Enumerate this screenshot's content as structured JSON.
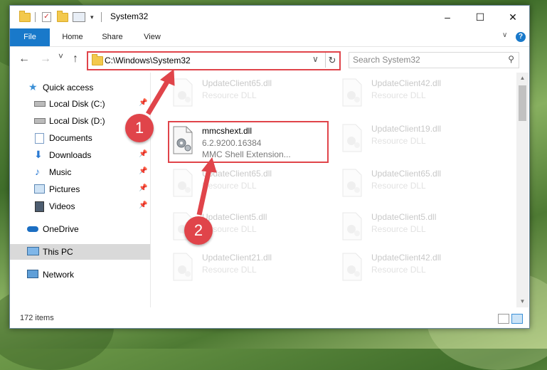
{
  "window": {
    "title": "System32",
    "controls": {
      "minimize": "–",
      "maximize": "☐",
      "close": "✕"
    }
  },
  "ribbon": {
    "tabs": [
      "File",
      "Home",
      "Share",
      "View"
    ],
    "collapse_glyph": "∨",
    "help_glyph": "?"
  },
  "navigation": {
    "back_glyph": "←",
    "forward_glyph": "→",
    "recent_glyph": "˅",
    "up_glyph": "↑",
    "address": "C:\\Windows\\System32",
    "address_drop_glyph": "∨",
    "refresh_glyph": "↻",
    "search_placeholder": "Search System32",
    "search_glyph": "⚲"
  },
  "sidebar": {
    "items": [
      {
        "label": "Quick access",
        "icon": "star-icon",
        "pinned": false
      },
      {
        "label": "Local Disk (C:)",
        "icon": "drive-icon",
        "pinned": true
      },
      {
        "label": "Local Disk (D:)",
        "icon": "drive-icon",
        "pinned": false
      },
      {
        "label": "Documents",
        "icon": "documents-icon",
        "pinned": true
      },
      {
        "label": "Downloads",
        "icon": "downloads-icon",
        "pinned": true
      },
      {
        "label": "Music",
        "icon": "music-icon",
        "pinned": true
      },
      {
        "label": "Pictures",
        "icon": "pictures-icon",
        "pinned": true
      },
      {
        "label": "Videos",
        "icon": "videos-icon",
        "pinned": true
      },
      {
        "label": "OneDrive",
        "icon": "cloud-icon",
        "pinned": false
      },
      {
        "label": "This PC",
        "icon": "computer-icon",
        "pinned": false,
        "selected": true
      },
      {
        "label": "Network",
        "icon": "network-icon",
        "pinned": false
      }
    ],
    "pin_glyph": "📌"
  },
  "files": {
    "left_column": [
      {
        "name": "UpdateClient65.dll",
        "desc": "Resource DLL"
      },
      {
        "name": "mmcshext.dll",
        "version": "6.2.9200.16384",
        "desc": "MMC Shell Extension...",
        "highlighted": true
      },
      {
        "name": "UpdateClient65.dll",
        "desc": "Resource DLL"
      },
      {
        "name": "UpdateClient5.dll",
        "desc": "Resource DLL"
      },
      {
        "name": "UpdateClient21.dll",
        "desc": "Resource DLL"
      }
    ],
    "right_column": [
      {
        "name": "UpdateClient42.dll",
        "desc": "Resource DLL"
      },
      {
        "name": "UpdateClient19.dll",
        "desc": "Resource DLL"
      },
      {
        "name": "UpdateClient65.dll",
        "desc": "Resource DLL"
      },
      {
        "name": "UpdateClient5.dll",
        "desc": "Resource DLL"
      },
      {
        "name": "UpdateClient42.dll",
        "desc": "Resource DLL"
      }
    ]
  },
  "status": {
    "item_count": "172 items"
  },
  "callouts": [
    "1",
    "2"
  ],
  "colors": {
    "accent": "#1979ca",
    "highlight": "#e0444a"
  }
}
